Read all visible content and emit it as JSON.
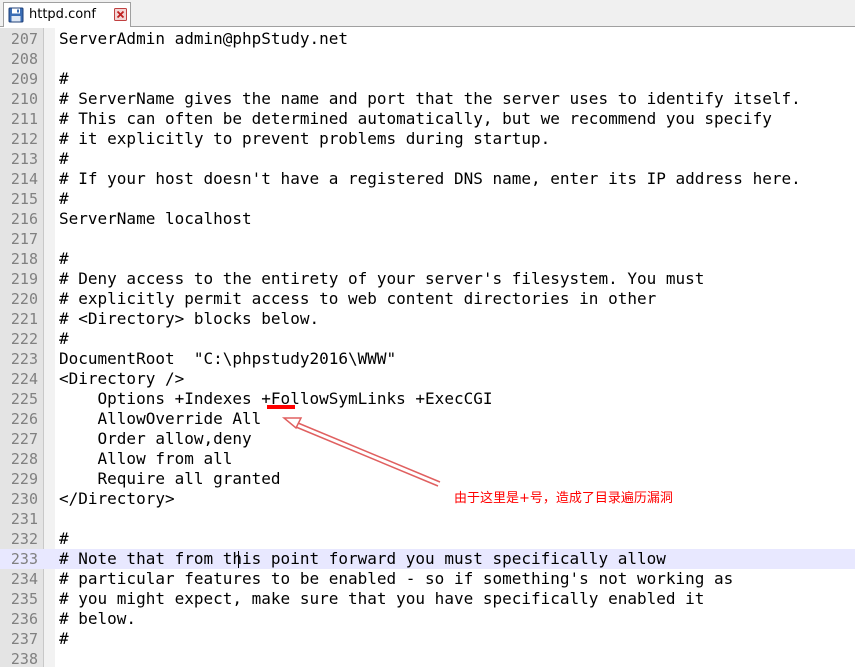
{
  "tab": {
    "label": "httpd.conf",
    "icon": "floppy-disk-icon",
    "close_icon": "close-icon",
    "accent": "#d9302c"
  },
  "editor": {
    "current_line": 233,
    "lines": [
      {
        "n": "207",
        "t": "ServerAdmin admin@phpStudy.net"
      },
      {
        "n": "208",
        "t": ""
      },
      {
        "n": "209",
        "t": "#"
      },
      {
        "n": "210",
        "t": "# ServerName gives the name and port that the server uses to identify itself."
      },
      {
        "n": "211",
        "t": "# This can often be determined automatically, but we recommend you specify"
      },
      {
        "n": "212",
        "t": "# it explicitly to prevent problems during startup."
      },
      {
        "n": "213",
        "t": "#"
      },
      {
        "n": "214",
        "t": "# If your host doesn't have a registered DNS name, enter its IP address here."
      },
      {
        "n": "215",
        "t": "#"
      },
      {
        "n": "216",
        "t": "ServerName localhost"
      },
      {
        "n": "217",
        "t": ""
      },
      {
        "n": "218",
        "t": "#"
      },
      {
        "n": "219",
        "t": "# Deny access to the entirety of your server's filesystem. You must"
      },
      {
        "n": "220",
        "t": "# explicitly permit access to web content directories in other"
      },
      {
        "n": "221",
        "t": "# <Directory> blocks below."
      },
      {
        "n": "222",
        "t": "#"
      },
      {
        "n": "223",
        "t": "DocumentRoot  \"C:\\phpstudy2016\\WWW\""
      },
      {
        "n": "224",
        "t": "<Directory />"
      },
      {
        "n": "225",
        "t": "    Options +Indexes +FollowSymLinks +ExecCGI"
      },
      {
        "n": "226",
        "t": "    AllowOverride All"
      },
      {
        "n": "227",
        "t": "    Order allow,deny"
      },
      {
        "n": "228",
        "t": "    Allow from all"
      },
      {
        "n": "229",
        "t": "    Require all granted"
      },
      {
        "n": "230",
        "t": "</Directory>"
      },
      {
        "n": "231",
        "t": ""
      },
      {
        "n": "232",
        "t": "#"
      },
      {
        "n": "233",
        "t": "# Note that from this point forward you must specifically allow"
      },
      {
        "n": "234",
        "t": "# particular features to be enabled - so if something's not working as"
      },
      {
        "n": "235",
        "t": "# you might expect, make sure that you have specifically enabled it"
      },
      {
        "n": "236",
        "t": "# below."
      },
      {
        "n": "237",
        "t": "#"
      },
      {
        "n": "238",
        "t": ""
      }
    ]
  },
  "annotation": {
    "text": "由于这里是+号，造成了目录遍历漏洞",
    "color": "#ff0000"
  }
}
